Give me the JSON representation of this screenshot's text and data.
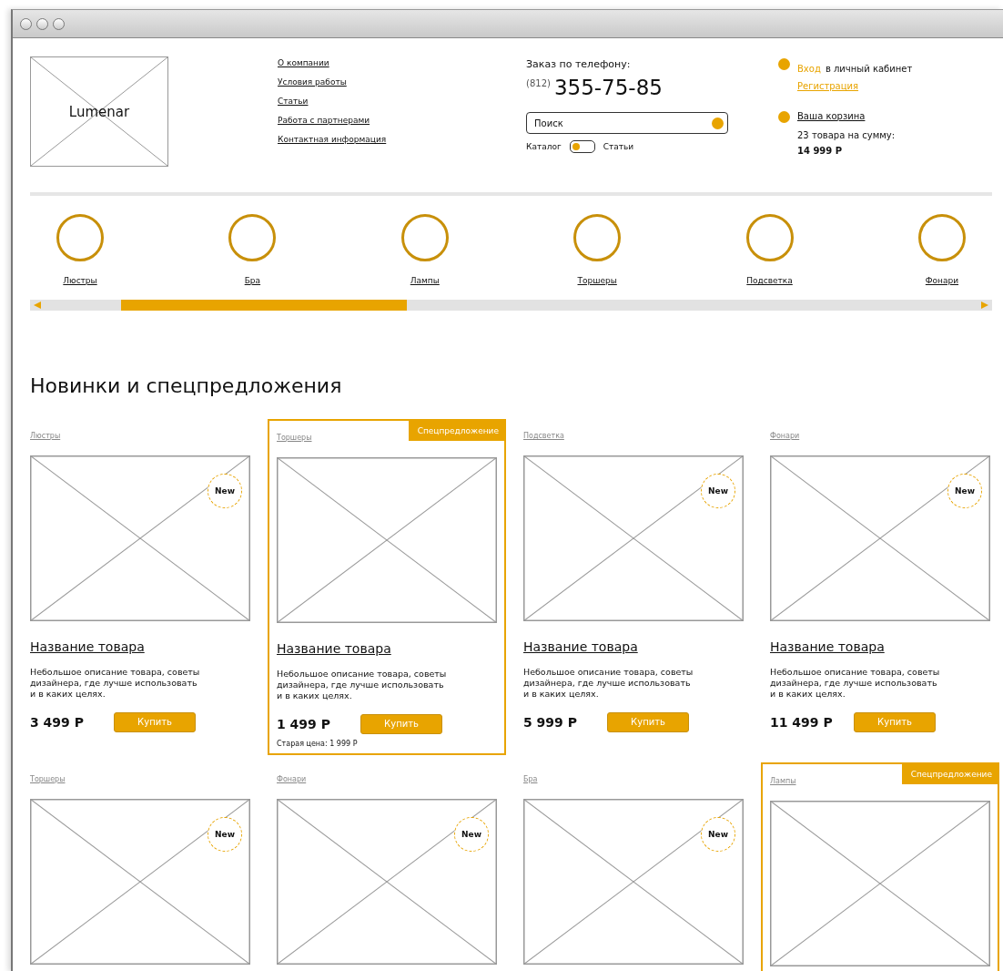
{
  "header": {
    "logo": "Lumenar",
    "nav": [
      "О компании",
      "Условия работы",
      "Статьи",
      "Работа с партнерами",
      "Контактная информация"
    ],
    "phone_label": "Заказ по телефону:",
    "phone_code": "(812)",
    "phone_number": "355-75-85",
    "search": {
      "placeholder": "Поиск"
    },
    "switch": {
      "left": "Каталог",
      "right": "Статьи",
      "on": false
    },
    "login_link": "Вход",
    "login_text": "в личный кабинет",
    "register_link": "Регистрация",
    "cart_link": "Ваша корзина",
    "cart_count": "23 товара на сумму:",
    "cart_total": "14 999 Р"
  },
  "categories": [
    "Люстры",
    "Бра",
    "Лампы",
    "Торшеры",
    "Подсветка",
    "Фонари"
  ],
  "section_title": "Новинки и спецпредложения",
  "products": [
    {
      "category": "Люстры",
      "kind": "regular",
      "badge": "New",
      "title": "Название товара",
      "description": "Небольшое описание товара, советы дизайнера, где лучше использовать и в каких целях.",
      "price": "3 499 Р",
      "button": "Купить"
    },
    {
      "category": "Торшеры",
      "kind": "special",
      "special_label": "Спецпредложение",
      "title": "Название товара",
      "description": "Небольшое описание товара, советы дизайнера, где лучше использовать и в каких целях.",
      "price": "1 499 Р",
      "button": "Купить",
      "old_price": "Старая цена: 1 999 Р"
    },
    {
      "category": "Подсветка",
      "kind": "regular",
      "badge": "New",
      "title": "Название товара",
      "description": "Небольшое описание товара, советы дизайнера, где лучше использовать и в каких целях.",
      "price": "5 999 Р",
      "button": "Купить"
    },
    {
      "category": "Фонари",
      "kind": "regular",
      "badge": "New",
      "title": "Название товара",
      "description": "Небольшое описание товара, советы дизайнера, где лучше использовать и в каких целях.",
      "price": "11 499 Р",
      "button": "Купить"
    },
    {
      "category": "Торшеры",
      "kind": "regular",
      "badge": "New"
    },
    {
      "category": "Фонари",
      "kind": "regular",
      "badge": "New"
    },
    {
      "category": "Бра",
      "kind": "regular",
      "badge": "New"
    },
    {
      "category": "Лампы",
      "kind": "special",
      "special_label": "Спецпредложение"
    }
  ]
}
